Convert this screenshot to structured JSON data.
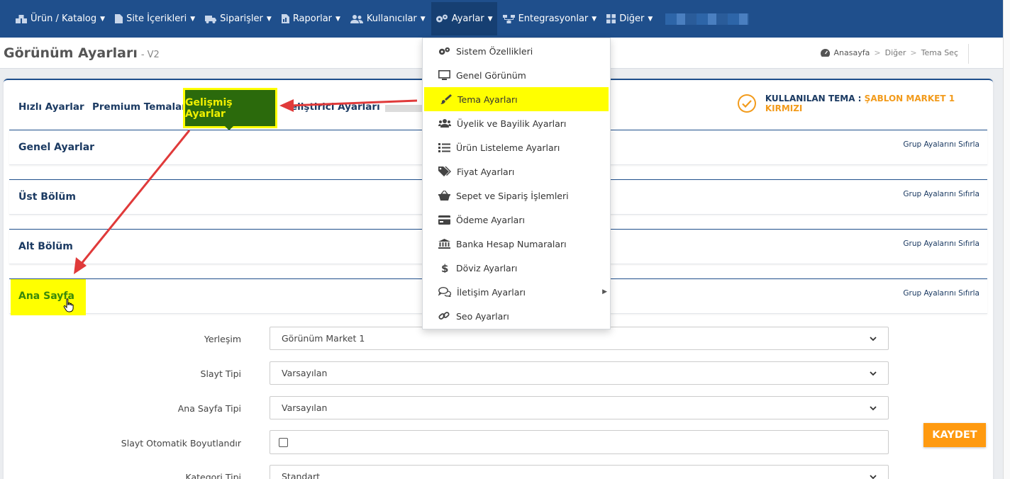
{
  "nav": {
    "items": [
      {
        "label": "Ürün / Katalog",
        "icon": "cubes-icon"
      },
      {
        "label": "Site İçerikleri",
        "icon": "file-icon"
      },
      {
        "label": "Siparişler",
        "icon": "truck-icon"
      },
      {
        "label": "Raporlar",
        "icon": "report-icon"
      },
      {
        "label": "Kullanıcılar",
        "icon": "users-icon"
      },
      {
        "label": "Ayarlar",
        "icon": "gears-icon"
      },
      {
        "label": "Entegrasyonlar",
        "icon": "sitemap-icon"
      },
      {
        "label": "Diğer",
        "icon": "grid-icon"
      }
    ]
  },
  "header": {
    "title": "Görünüm Ayarları",
    "subtitle": "- V2",
    "breadcrumb": [
      "Anasayfa",
      "Diğer",
      "Tema Seç"
    ],
    "breadcrumb_sep": ">"
  },
  "tabs": {
    "quick": "Hızlı Ayarlar",
    "premium": "Premium Temalar",
    "advanced": "Gelişmiş Ayarlar",
    "developer_partial": "eliştirici Ayarları"
  },
  "theme": {
    "label": "KULLANILAN TEMA :",
    "value": "ŞABLON MARKET 1 KIRMIZI"
  },
  "sections": [
    {
      "title": "Genel Ayarlar",
      "reset": "Grup Ayalarını Sıfırla"
    },
    {
      "title": "Üst Bölüm",
      "reset": "Grup Ayalarını Sıfırla"
    },
    {
      "title": "Alt Bölüm",
      "reset": "Grup Ayalarını Sıfırla"
    },
    {
      "title": "Ana Sayfa",
      "reset": "Grup Ayalarını Sıfırla"
    }
  ],
  "form": {
    "layout_label": "Yerleşim",
    "layout_value": "Görünüm Market 1",
    "slider_type_label": "Slayt Tipi",
    "slider_type_value": "Varsayılan",
    "home_type_label": "Ana Sayfa Tipi",
    "home_type_value": "Varsayılan",
    "slider_autosize_label": "Slayt Otomatik Boyutlandır",
    "category_type_label": "Kategori Tipi",
    "category_type_value": "Standart"
  },
  "dropdown": {
    "items": [
      {
        "label": "Sistem Özellikleri",
        "icon": "gears-icon"
      },
      {
        "label": "Genel Görünüm",
        "icon": "monitor-icon"
      },
      {
        "label": "Tema Ayarları",
        "icon": "brush-icon"
      },
      {
        "label": "Üyelik ve Bayilik Ayarları",
        "icon": "users-icon"
      },
      {
        "label": "Ürün Listeleme Ayarları",
        "icon": "list-icon"
      },
      {
        "label": "Fiyat Ayarları",
        "icon": "tags-icon"
      },
      {
        "label": "Sepet ve Sipariş İşlemleri",
        "icon": "basket-icon"
      },
      {
        "label": "Ödeme Ayarları",
        "icon": "credit-card-icon"
      },
      {
        "label": "Banka Hesap Numaraları",
        "icon": "bank-icon"
      },
      {
        "label": "Döviz Ayarları",
        "icon": "dollar-icon"
      },
      {
        "label": "İletişim Ayarları",
        "icon": "comments-icon"
      },
      {
        "label": "Seo Ayarları",
        "icon": "link-icon"
      }
    ]
  },
  "save_label": "KAYDET",
  "colors": {
    "nav_bg": "#1f4f8c",
    "highlight": "#ffff00",
    "active_tab": "#2b6a0c",
    "accent_orange": "#f29b1c",
    "arrow_red": "#e03a3a"
  }
}
